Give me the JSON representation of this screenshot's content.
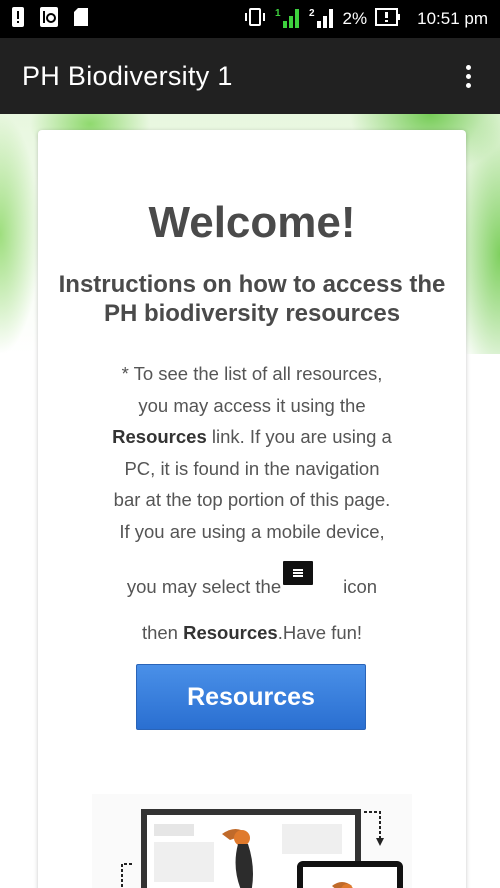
{
  "status_bar": {
    "battery_percent": "2%",
    "time": "10:51 pm",
    "icons": [
      "alert-icon",
      "sync-icon",
      "sd-card-icon",
      "vibrate-icon",
      "signal-1-icon",
      "signal-2-icon",
      "battery-icon"
    ]
  },
  "app_bar": {
    "title": "PH Biodiversity 1",
    "menu_icon": "overflow-menu-icon"
  },
  "card": {
    "heading": "Welcome!",
    "subtitle": "Instructions on how to access the PH biodiversity resources",
    "instructions": {
      "line1": "* To see the list of all resources,",
      "line2": "you may access it using the",
      "line3_bold": "Resources",
      "line3_rest": " link. If you are using a",
      "line4": "PC, it is found in the navigation",
      "line5": "bar at the top portion of this page.",
      "line6": "If you are using a mobile device,",
      "line7_a": "you may select the",
      "line7_b": "icon",
      "line8_a": "then ",
      "line8_bold": "Resources",
      "line8_b": ".Have fun!"
    },
    "button_label": "Resources"
  },
  "colors": {
    "status_bar": "#000000",
    "app_bar": "#212121",
    "button": "#2f78d8",
    "heading": "#4a4a4a",
    "signal_green": "#3ed13e"
  }
}
